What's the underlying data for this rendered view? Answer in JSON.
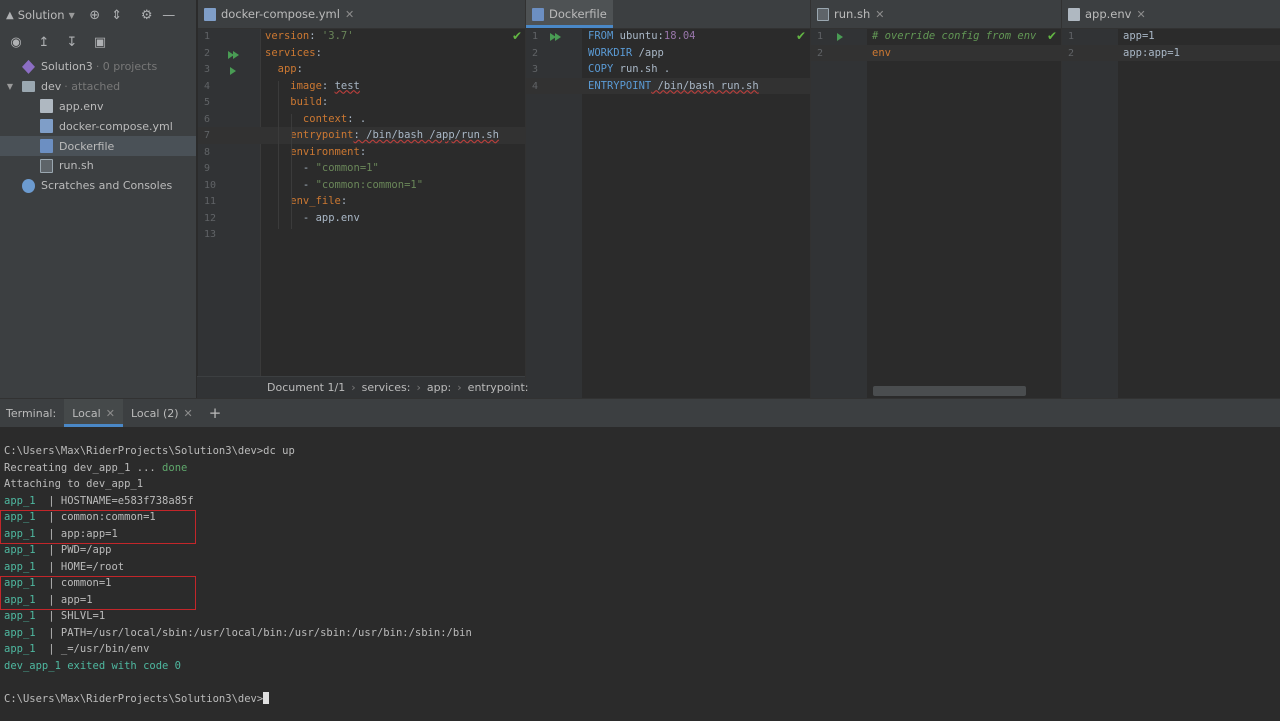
{
  "sidebar": {
    "title": "Solution",
    "tree": [
      {
        "label": "Solution3",
        "muted": "· 0 projects",
        "icon": "solution-icon"
      },
      {
        "label": "dev",
        "muted": "· attached",
        "icon": "folder-icon"
      },
      {
        "label": "app.env",
        "muted": "",
        "icon": "env-file-icon"
      },
      {
        "label": "docker-compose.yml",
        "muted": "",
        "icon": "docker-compose-icon"
      },
      {
        "label": "Dockerfile",
        "muted": "",
        "icon": "dockerfile-icon"
      },
      {
        "label": "run.sh",
        "muted": "",
        "icon": "shell-script-icon"
      },
      {
        "label": "Scratches and Consoles",
        "muted": "",
        "icon": "scratches-icon"
      }
    ]
  },
  "tabs": {
    "compose": "docker-compose.yml",
    "dockerfile": "Dockerfile",
    "runsh": "run.sh",
    "appenv": "app.env"
  },
  "compose_editor": {
    "line_numbers": [
      "1",
      "2",
      "3",
      "4",
      "5",
      "6",
      "7",
      "8",
      "9",
      "10",
      "11",
      "12",
      "13"
    ],
    "lines": [
      [
        [
          "k-key",
          "version"
        ],
        [
          "k-plain",
          ": "
        ],
        [
          "k-str",
          "'3.7'"
        ]
      ],
      [
        [
          "k-key",
          "services"
        ],
        [
          "k-plain",
          ":"
        ]
      ],
      [
        [
          "k-key",
          "  app"
        ],
        [
          "k-plain",
          ":"
        ]
      ],
      [
        [
          "k-key",
          "    image"
        ],
        [
          "k-plain",
          ": "
        ],
        [
          "k-plain",
          "test"
        ]
      ],
      [
        [
          "k-key",
          "    build"
        ],
        [
          "k-plain",
          ":"
        ]
      ],
      [
        [
          "k-key",
          "      context"
        ],
        [
          "k-plain",
          ": ."
        ]
      ],
      [
        [
          "k-key",
          "    entrypoint"
        ],
        [
          "k-plain",
          ": /bin/bash /app/run.sh"
        ]
      ],
      [
        [
          "k-key",
          "    environment"
        ],
        [
          "k-plain",
          ":"
        ]
      ],
      [
        [
          "k-plain",
          "      - "
        ],
        [
          "k-str",
          "\"common=1\""
        ]
      ],
      [
        [
          "k-plain",
          "      - "
        ],
        [
          "k-str",
          "\"common:common=1\""
        ]
      ],
      [
        [
          "k-key",
          "    env_file"
        ],
        [
          "k-plain",
          ":"
        ]
      ],
      [
        [
          "k-plain",
          "      - app.env"
        ]
      ],
      [
        [
          "k-plain",
          ""
        ]
      ]
    ]
  },
  "breadcrumb": [
    "Document 1/1",
    "services:",
    "app:",
    "entrypoint:"
  ],
  "dockerfile_editor": {
    "line_numbers": [
      "1",
      "2",
      "3",
      "4"
    ],
    "lines": [
      [
        [
          "k-dkey",
          "FROM"
        ],
        [
          "k-plain",
          " ubuntu:"
        ],
        [
          "k-purple",
          "18.04"
        ]
      ],
      [
        [
          "k-dkey",
          "WORKDIR"
        ],
        [
          "k-plain",
          " /app"
        ]
      ],
      [
        [
          "k-dkey",
          "COPY"
        ],
        [
          "k-plain",
          " run.sh ."
        ]
      ],
      [
        [
          "k-dkey",
          "ENTRYPOINT"
        ],
        [
          "k-plain",
          " /bin/bash run.sh"
        ]
      ]
    ]
  },
  "runsh_editor": {
    "line_numbers": [
      "1",
      "2"
    ],
    "lines": [
      [
        [
          "k-comment",
          "# override config from env"
        ]
      ],
      [
        [
          "k-key",
          "env"
        ]
      ]
    ]
  },
  "appenv_editor": {
    "line_numbers": [
      "1",
      "2"
    ],
    "lines": [
      [
        [
          "k-plain",
          "app=1"
        ]
      ],
      [
        [
          "k-plain",
          "app:app=1"
        ]
      ]
    ]
  },
  "terminal": {
    "label": "Terminal:",
    "tabs": [
      "Local",
      "Local (2)"
    ],
    "lines": [
      {
        "prefix": "",
        "text": "C:\\Users\\Max\\RiderProjects\\Solution3\\dev>dc up",
        "suffix": ""
      },
      {
        "prefix": "",
        "text": "Recreating dev_app_1 ... ",
        "suffix": "done"
      },
      {
        "prefix": "",
        "text": "Attaching to dev_app_1",
        "suffix": ""
      },
      {
        "prefix": "app_1  ",
        "text": "| HOSTNAME=e583f738a85f",
        "suffix": ""
      },
      {
        "prefix": "app_1  ",
        "text": "| common:common=1",
        "suffix": ""
      },
      {
        "prefix": "app_1  ",
        "text": "| app:app=1",
        "suffix": ""
      },
      {
        "prefix": "app_1  ",
        "text": "| PWD=/app",
        "suffix": ""
      },
      {
        "prefix": "app_1  ",
        "text": "| HOME=/root",
        "suffix": ""
      },
      {
        "prefix": "app_1  ",
        "text": "| common=1",
        "suffix": ""
      },
      {
        "prefix": "app_1  ",
        "text": "| app=1",
        "suffix": ""
      },
      {
        "prefix": "app_1  ",
        "text": "| SHLVL=1",
        "suffix": ""
      },
      {
        "prefix": "app_1  ",
        "text": "| PATH=/usr/local/sbin:/usr/local/bin:/usr/sbin:/usr/bin:/sbin:/bin",
        "suffix": ""
      },
      {
        "prefix": "app_1  ",
        "text": "| _=/usr/bin/env",
        "suffix": ""
      },
      {
        "prefix": "dev_app_1 exited with code 0",
        "text": "",
        "suffix": ""
      },
      {
        "prefix": "",
        "text": "",
        "suffix": ""
      },
      {
        "prefix": "",
        "text": "C:\\Users\\Max\\RiderProjects\\Solution3\\dev>",
        "suffix": ""
      }
    ]
  },
  "colors": {
    "accent": "#4a88c7",
    "highlight_box": "#c3262a",
    "terminal_prefix": "#4eb8a0"
  }
}
